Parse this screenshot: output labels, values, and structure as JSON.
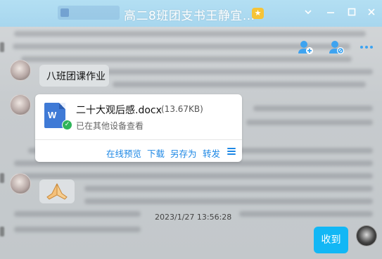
{
  "window": {
    "title": "高二8班团支书王静宜...",
    "buttons": {
      "collapse": "⌄",
      "minimize": "—",
      "maximize": "☐",
      "close": "✕"
    },
    "title_badge_icon": "star-badge-icon"
  },
  "toolbar": {
    "icons": [
      "add-member-icon",
      "manage-member-icon",
      "more-icon"
    ]
  },
  "messages": [
    {
      "type": "text",
      "text": "八班团课作业",
      "avatar": "avatar"
    },
    {
      "type": "file",
      "file_name": "二十大观后感.docx",
      "file_size": "(13.67KB)",
      "status": "已在其他设备查看",
      "file_icon": "word-doc-icon",
      "actions": {
        "preview": "在线预览",
        "download": "下载",
        "save_as": "另存为",
        "forward": "转发"
      }
    },
    {
      "type": "emoji",
      "emoji": "🙏"
    }
  ],
  "timestamp": "2023/1/27 13:56:28",
  "self_message": {
    "text": "收到"
  },
  "colors": {
    "titlebar": "#a9d8ef",
    "accent_blue": "#1e88e5",
    "sent_bubble": "#12b7f5",
    "check_green": "#2fb45a"
  }
}
